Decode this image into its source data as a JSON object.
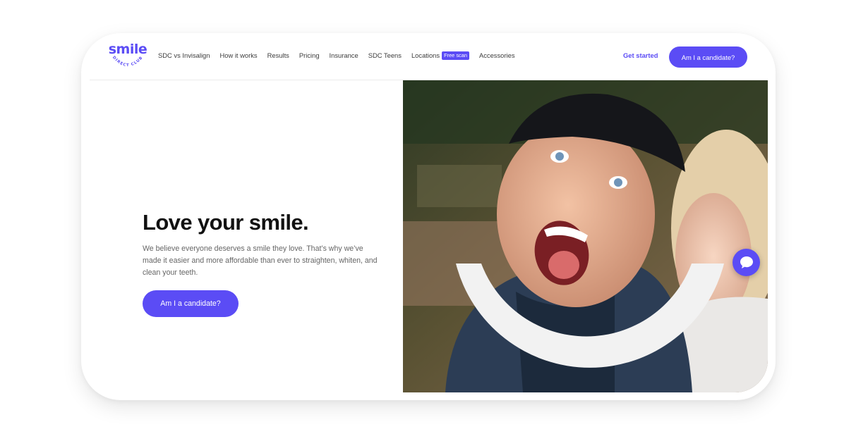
{
  "brand": {
    "name": "smile",
    "tagline": "DIRECT CLUB",
    "accent_color": "#5b4cf5"
  },
  "nav": {
    "links": [
      "SDC vs Invisalign",
      "How it works",
      "Results",
      "Pricing",
      "Insurance",
      "SDC Teens",
      "Locations",
      "Accessories"
    ],
    "locations_badge": "Free scan",
    "get_started": "Get started",
    "cta": "Am I a candidate?"
  },
  "hero": {
    "title": "Love your smile.",
    "text": "We believe everyone deserves a smile they love. That’s why we’ve made it easier and more affordable than ever to straighten, whiten, and clean your teeth.",
    "cta": "Am I a candidate?",
    "image_icon": "couple-photo",
    "overlay_icon": "smile-arc"
  },
  "chat": {
    "icon": "chat-bubble-icon"
  }
}
